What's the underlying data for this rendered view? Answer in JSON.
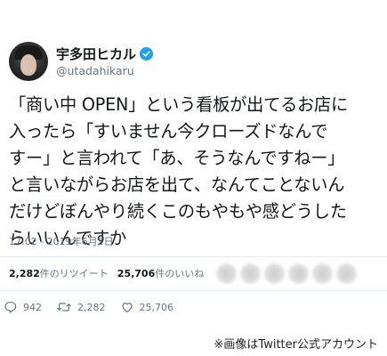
{
  "user": {
    "display_name": "宇多田ヒカル",
    "handle": "@utadahikaru",
    "verified": true,
    "accent_color": "#1da1f2"
  },
  "tweet": {
    "text_lines": [
      "「商い中 OPEN」という看板が出てるお店に",
      "入ったら「すいません今クローズドなんで",
      "すー」と言われて「あ、そうなんですねー」",
      "と言いながらお店を出て、なんてことないん",
      "だけどぼんやり続くこのもやもや感どうした",
      "らいいんですか"
    ],
    "timestamp": "17:02 - 2019年6月2日"
  },
  "stats": {
    "retweets_count": "2,282",
    "retweets_label": "件のリツイート",
    "likes_count": "25,706",
    "likes_label": "件のいいね"
  },
  "actions": {
    "reply_count": "942",
    "retweet_count": "2,282",
    "like_count": "25,706"
  },
  "icons": [
    "verified-badge-icon",
    "reply-icon",
    "retweet-icon",
    "like-icon"
  ],
  "caption": "※画像はTwitter公式アカウント"
}
